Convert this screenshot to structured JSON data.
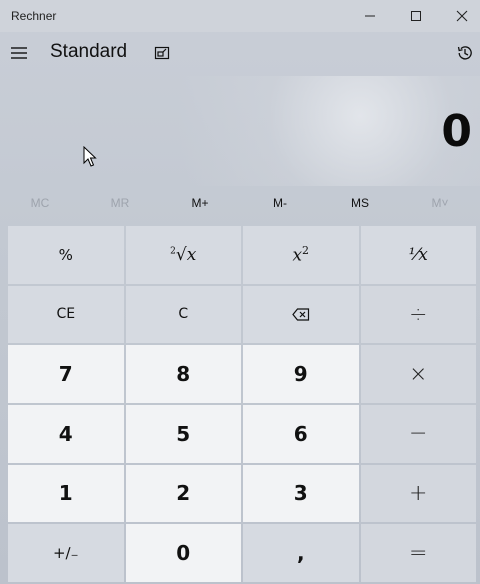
{
  "window": {
    "title": "Rechner",
    "minimize_icon": "minimize-icon",
    "maximize_icon": "maximize-icon",
    "close_icon": "close-icon"
  },
  "header": {
    "menu_icon": "hamburger-icon",
    "mode": "Standard",
    "keep_on_top_icon": "keep-on-top-icon",
    "history_icon": "history-icon"
  },
  "display": {
    "value": "0"
  },
  "memory": [
    {
      "label": "MC",
      "enabled": false
    },
    {
      "label": "MR",
      "enabled": false
    },
    {
      "label": "M+",
      "enabled": true
    },
    {
      "label": "M-",
      "enabled": true
    },
    {
      "label": "MS",
      "enabled": true
    },
    {
      "label": "M˅",
      "enabled": false
    }
  ],
  "keys": {
    "percent": "%",
    "sqrt_index": "2",
    "sqrt": "√x",
    "square": "x",
    "square_exp": "2",
    "reciprocal": "⅟x",
    "ce": "CE",
    "c": "C",
    "backspace_icon": "backspace-icon",
    "divide": "÷",
    "seven": "7",
    "eight": "8",
    "nine": "9",
    "multiply": "×",
    "four": "4",
    "five": "5",
    "six": "6",
    "minus": "−",
    "one": "1",
    "two": "2",
    "three": "3",
    "plus": "+",
    "negate": "+∕₋",
    "zero": "0",
    "decimal": ",",
    "equals": "="
  },
  "colors": {
    "number_key_bg": "#f2f3f5",
    "function_key_bg": "#d6dae1",
    "background": "#c3c9d2"
  }
}
